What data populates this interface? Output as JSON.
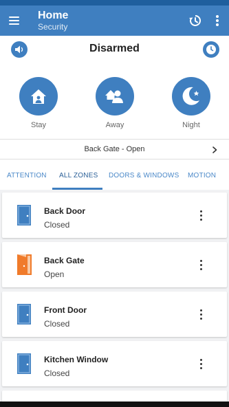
{
  "app_bar": {
    "title": "Home",
    "subtitle": "Security"
  },
  "security": {
    "status": "Disarmed"
  },
  "modes": [
    {
      "label": "Stay",
      "icon": "home-stay-icon"
    },
    {
      "label": "Away",
      "icon": "people-away-icon"
    },
    {
      "label": "Night",
      "icon": "moon-night-icon"
    }
  ],
  "notice": {
    "text": "Back Gate - Open"
  },
  "tabs": [
    {
      "label": "ATTENTION",
      "active": false
    },
    {
      "label": "ALL ZONES",
      "active": true
    },
    {
      "label": "DOORS & WINDOWS",
      "active": false
    },
    {
      "label": "MOTION",
      "active": false
    }
  ],
  "zones": [
    {
      "name": "Back Door",
      "state": "Closed",
      "icon": "door-closed-icon",
      "color": "#3f7fc0"
    },
    {
      "name": "Back Gate",
      "state": "Open",
      "icon": "door-open-icon",
      "color": "#f07b2b"
    },
    {
      "name": "Front Door",
      "state": "Closed",
      "icon": "door-closed-icon",
      "color": "#3f7fc0"
    },
    {
      "name": "Kitchen Window",
      "state": "Closed",
      "icon": "window-closed-icon",
      "color": "#3f7fc0"
    }
  ],
  "colors": {
    "primary": "#3f7fc0",
    "primary_dark": "#1f5f9e",
    "alert": "#f07b2b",
    "list_bg": "#f1f2f4"
  }
}
